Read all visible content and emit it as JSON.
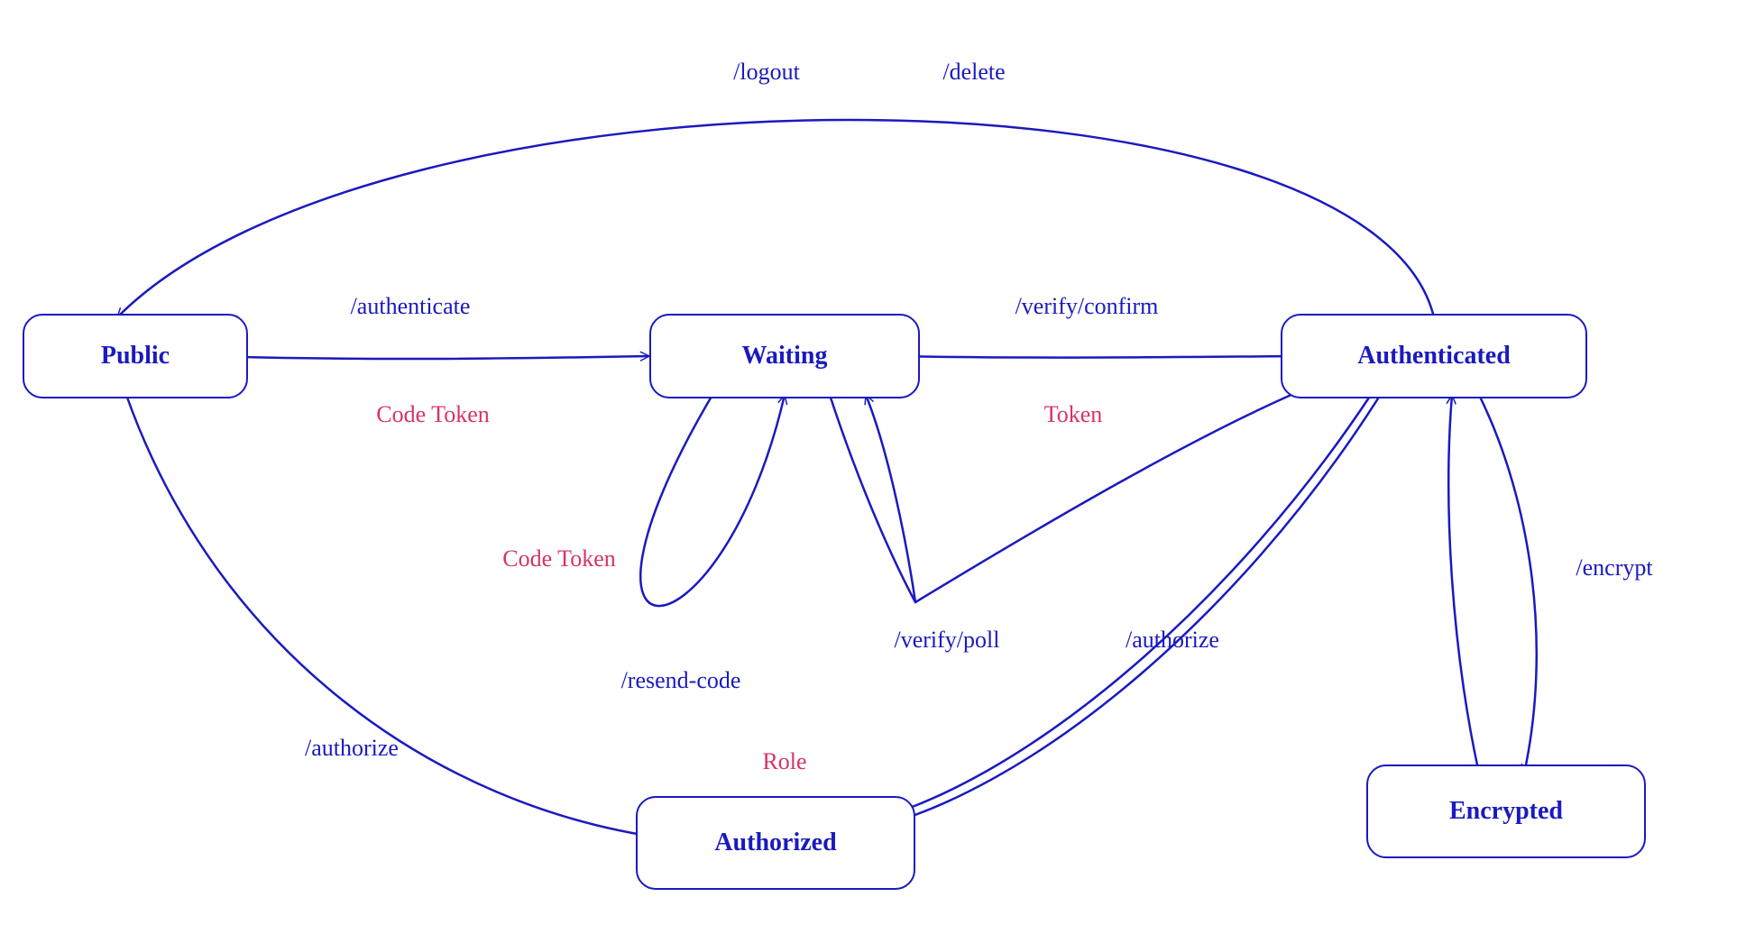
{
  "colors": {
    "stroke": "#1a1abf",
    "accent": "#d6336c"
  },
  "nodes": {
    "public": {
      "label": "Public"
    },
    "waiting": {
      "label": "Waiting"
    },
    "authenticated": {
      "label": "Authenticated"
    },
    "authorized": {
      "label": "Authorized"
    },
    "encrypted": {
      "label": "Encrypted"
    }
  },
  "edges": {
    "authenticate": {
      "label": "/authenticate",
      "from": "public",
      "to": "waiting",
      "payload": "Code Token"
    },
    "verify_confirm": {
      "label": "/verify/confirm",
      "from": "waiting",
      "to": "authenticated",
      "payload": "Token"
    },
    "logout": {
      "label": "/logout",
      "from": "authenticated",
      "to": "public"
    },
    "delete": {
      "label": "/delete",
      "from": "authenticated",
      "to": "public"
    },
    "resend_code": {
      "label": "/resend-code",
      "from": "waiting",
      "to": "waiting",
      "payload": "Code Token"
    },
    "verify_poll": {
      "label": "/verify/poll",
      "from": "waiting",
      "to": "authenticated"
    },
    "encrypt": {
      "label": "/encrypt",
      "from": "authenticated",
      "to": "encrypted"
    },
    "authorize_public": {
      "label": "/authorize",
      "from": "public",
      "to": "authorized",
      "payload": "Role"
    },
    "authorize_auth": {
      "label": "/authorize",
      "from": "authenticated",
      "to": "authorized"
    }
  }
}
